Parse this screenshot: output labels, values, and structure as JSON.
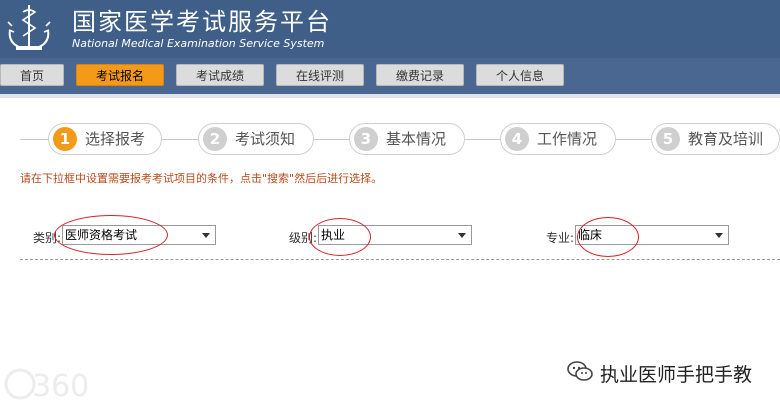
{
  "header": {
    "title": "国家医学考试服务平台",
    "subtitle": "National Medical Examination Service System"
  },
  "nav": {
    "items": [
      {
        "label": "首页"
      },
      {
        "label": "考试报名",
        "active": true
      },
      {
        "label": "考试成绩"
      },
      {
        "label": "在线评测"
      },
      {
        "label": "缴费记录"
      },
      {
        "label": "个人信息"
      }
    ]
  },
  "steps": [
    {
      "num": "1",
      "label": "选择报考",
      "active": true
    },
    {
      "num": "2",
      "label": "考试须知"
    },
    {
      "num": "3",
      "label": "基本情况"
    },
    {
      "num": "4",
      "label": "工作情况"
    },
    {
      "num": "5",
      "label": "教育及培训"
    }
  ],
  "instruction": "请在下拉框中设置需要报考考试项目的条件，点击\"搜索\"然后后进行选择。",
  "filters": {
    "category": {
      "label": "类别:",
      "value": "医师资格考试"
    },
    "level": {
      "label": "级别:",
      "value": "执业"
    },
    "major": {
      "label": "专业:",
      "value": "临床"
    }
  },
  "watermark": {
    "text": "执业医师手把手教",
    "left_logo": "360"
  },
  "colors": {
    "header": "#3f5f89",
    "accent": "#f39a1b",
    "annotation": "#d6232a"
  }
}
